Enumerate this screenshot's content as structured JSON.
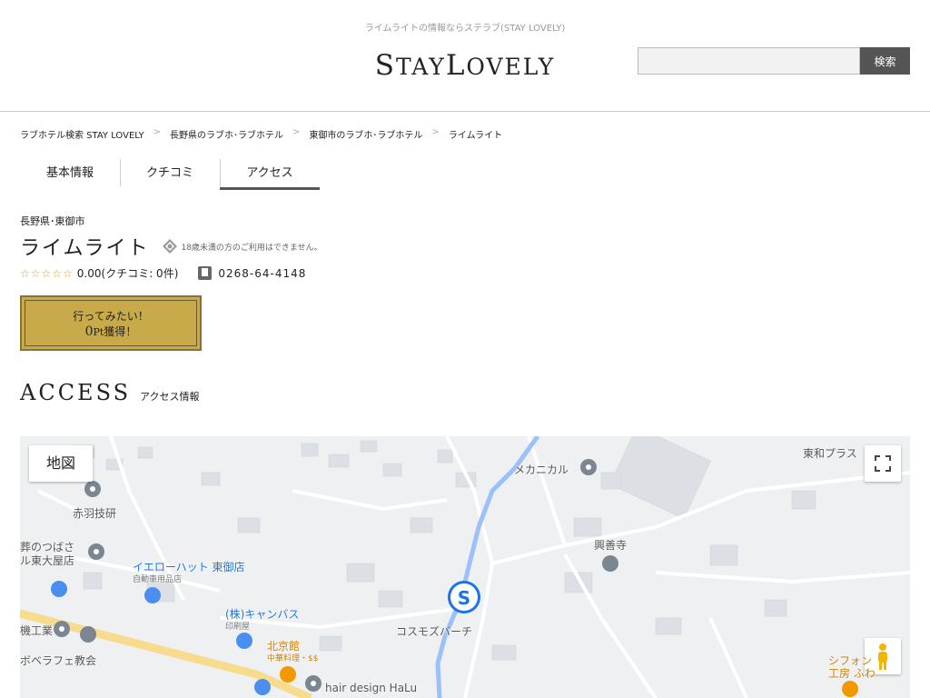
{
  "header": {
    "tagline": "ライムライトの情報ならステラブ(STAY LOVELY)",
    "logo": {
      "s": "S",
      "tay": "TAY",
      "l": "L",
      "ovely": "OVELY"
    },
    "search": {
      "value": "",
      "button": "検索"
    }
  },
  "breadcrumb": [
    "ラブホテル検索 STAY LOVELY",
    "長野県のラブホ･ラブホテル",
    "東御市のラブホ･ラブホテル",
    "ライムライト"
  ],
  "breadcrumb_sep": ">",
  "tabs": [
    {
      "label": "基本情報",
      "active": false
    },
    {
      "label": "クチコミ",
      "active": false
    },
    {
      "label": "アクセス",
      "active": true
    }
  ],
  "hotel": {
    "prefecture": "長野県･東御市",
    "name": "ライムライト",
    "age_note": "18歳未満の方のご利用はできません。",
    "stars_display": "☆☆☆☆☆",
    "rating": "0.00",
    "review_text": "(クチコミ: 0件)",
    "phone": "0268-64-4148"
  },
  "want_button": {
    "line1": "行ってみたい！",
    "points": "0",
    "pt_unit": "Pt",
    "line2_suffix": "獲得！"
  },
  "access": {
    "title_en": "ACCESS",
    "title_jp": "アクセス情報"
  },
  "map": {
    "type_button": "地図",
    "labels": {
      "akabane": "赤羽技研",
      "funeral": "葬のつばさ",
      "funeral2": "ル東大屋店",
      "yellowhat": "イエローハット 東御店",
      "yellowhat_sub": "自動車用品店",
      "canvas": "(株)キャンバス",
      "canvas_sub": "印刷屋",
      "pekinkan": "北京館",
      "pekinkan_sub": "中華料理・$$",
      "kogyo": "機工業",
      "church": "ボベラフェ教会",
      "hair": "hair design HaLu",
      "cosmos": "コスモズバーチ",
      "mechanic": "メカニカル",
      "kozenji": "興善寺",
      "towa": "東和プラス",
      "chiffon": "シフォン",
      "chiffon2": "工房 ふわ"
    }
  }
}
